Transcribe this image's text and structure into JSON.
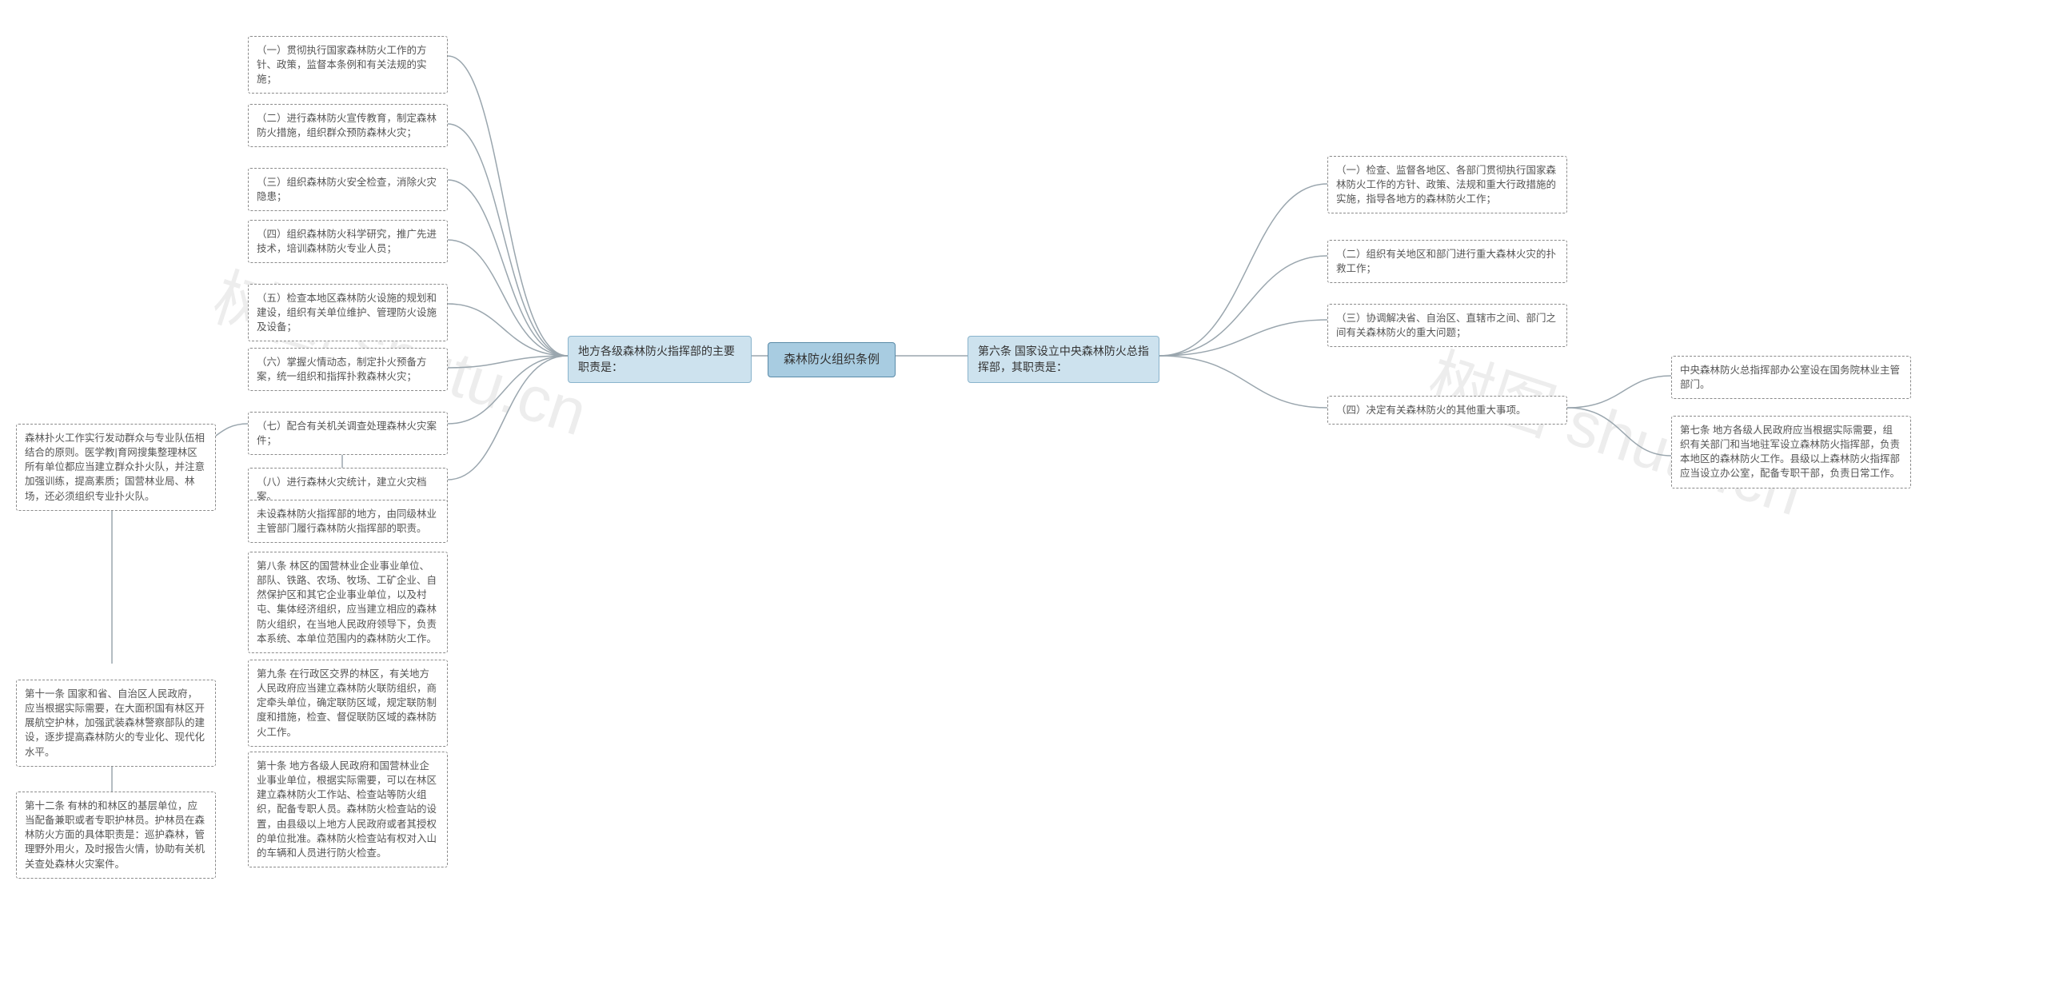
{
  "center": {
    "label": "森林防火组织条例"
  },
  "right": {
    "label": "第六条 国家设立中央森林防火总指挥部，其职责是：",
    "items": [
      "（一）检查、监督各地区、各部门贯彻执行国家森林防火工作的方针、政策、法规和重大行政措施的实施，指导各地方的森林防火工作；",
      "（二）组织有关地区和部门进行重大森林火灾的扑救工作；",
      "（三）协调解决省、自治区、直辖市之间、部门之间有关森林防火的重大问题；",
      "（四）决定有关森林防火的其他重大事项。"
    ],
    "attach": [
      "中央森林防火总指挥部办公室设在国务院林业主管部门。",
      "第七条 地方各级人民政府应当根据实际需要，组织有关部门和当地驻军设立森林防火指挥部，负责本地区的森林防火工作。县级以上森林防火指挥部应当设立办公室，配备专职干部，负责日常工作。"
    ]
  },
  "left": {
    "label": "地方各级森林防火指挥部的主要职责是：",
    "items": [
      "（一）贯彻执行国家森林防火工作的方针、政策，监督本条例和有关法规的实施；",
      "（二）进行森林防火宣传教育，制定森林防火措施，组织群众预防森林火灾；",
      "（三）组织森林防火安全检查，消除火灾隐患；",
      "（四）组织森林防火科学研究，推广先进技术，培训森林防火专业人员；",
      "（五）检查本地区森林防火设施的规划和建设，组织有关单位维护、管理防火设施及设备；",
      "（六）掌握火情动态，制定扑火预备方案，统一组织和指挥扑救森林火灾；",
      "（七）配合有关机关调查处理森林火灾案件；",
      "（八）进行森林火灾统计，建立火灾档案。"
    ],
    "attachA": [
      "未设森林防火指挥部的地方，由同级林业主管部门履行森林防火指挥部的职责。",
      "第八条 林区的国营林业企业事业单位、部队、铁路、农场、牧场、工矿企业、自然保护区和其它企业事业单位，以及村屯、集体经济组织，应当建立相应的森林防火组织，在当地人民政府领导下，负责本系统、本单位范围内的森林防火工作。",
      "第九条 在行政区交界的林区，有关地方人民政府应当建立森林防火联防组织，商定牵头单位，确定联防区域，规定联防制度和措施，检查、督促联防区域的森林防火工作。",
      "第十条 地方各级人民政府和国营林业企业事业单位，根据实际需要，可以在林区建立森林防火工作站、检查站等防火组织，配备专职人员。森林防火检查站的设置，由县级以上地方人民政府或者其授权的单位批准。森林防火检查站有权对入山的车辆和人员进行防火检查。"
    ],
    "attachB": [
      "森林扑火工作实行发动群众与专业队伍相结合的原则。医学教|育网搜集整理林区所有单位都应当建立群众扑火队，并注意加强训练，提高素质；国营林业局、林场，还必须组织专业扑火队。",
      "第十一条 国家和省、自治区人民政府，应当根据实际需要，在大面积国有林区开展航空护林，加强武装森林警察部队的建设，逐步提高森林防火的专业化、现代化水平。",
      "第十二条 有林的和林区的基层单位，应当配备兼职或者专职护林员。护林员在森林防火方面的具体职责是：巡护森林，管理野外用火，及时报告火情，协助有关机关查处森林火灾案件。"
    ]
  },
  "watermark": "树图 shutu.cn"
}
